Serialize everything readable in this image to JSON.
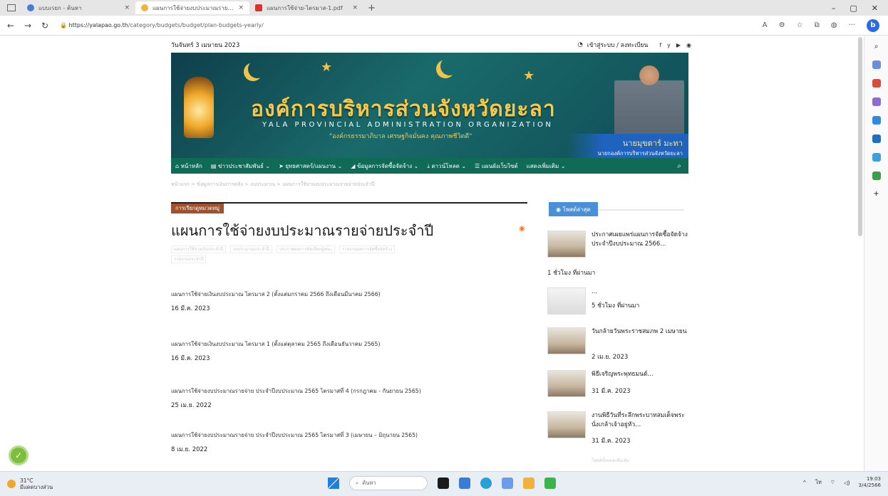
{
  "browser": {
    "tabs": [
      {
        "label": "แบบเรยก - ค้นหา",
        "favicon_color": "#4b7bd8",
        "active": false
      },
      {
        "label": "แผนการใช้จ่ายงบประมาณรายจ่ายประจ",
        "favicon_color": "#f0b43a",
        "active": true
      },
      {
        "label": "แผนการใช้จ่าย-ไตรมาส-1.pdf",
        "favicon_color": "#d9332a",
        "active": false
      }
    ],
    "new_tab_glyph": "+",
    "window_controls": [
      "–",
      "▢",
      "✕"
    ],
    "url_host": "https://yalapao.go.th",
    "url_path": "/category/budgets/budget/plan-budgets-yearly/",
    "bing_label": "b"
  },
  "header": {
    "date": "วันจันทร์ 3 เมษายน 2023",
    "login_label": "เข้าสู่ระบบ / ลงทะเบียน",
    "social": [
      "f",
      "y",
      "▶",
      "◉"
    ]
  },
  "banner": {
    "title": "องค์การบริหารส่วนจังหวัดยะลา",
    "subtitle": "YALA PROVINCIAL ADMINISTRATION ORGANIZATION",
    "motto": "\"องค์กรธรรมาภิบาล เศรษฐกิจมั่นคง คุณภาพชีวิตดี\"",
    "person_name": "นายมุขตาร์ มะทา",
    "person_role": "นายกองค์การบริหารส่วนจังหวัดยะลา"
  },
  "menu": {
    "items": [
      "หน้าหลัก",
      "ข่าวประชาสัมพันธ์",
      "ยุทธศาสตร์/แผนงาน",
      "ข้อมูลการจัดซื้อจัดจ้าง",
      "ดาวน์โหลด",
      "แผนผังเว็บไซต์",
      "แสดงเพิ่มเติม"
    ],
    "search_glyph": "⌕"
  },
  "breadcrumb": "หน้าแรก > ข้อมูลการเงินการคลัง > งบประมาณ > แผนการใช้จ่ายงบประมาณรายจ่ายประจำปี",
  "main": {
    "category_badge": "การเรียกดูหมวดหมู่",
    "title": "แผนการใช้จ่ายงบประมาณรายจ่ายประจำปี",
    "tags": [
      "แผนการใช้จ่ายเงินประจำปี",
      "งบประมาณประจำปี",
      "ประกาศผลการคัดเลือกผู้ชนะ",
      "รายงานผลการจัดซื้อจัดจ้าง",
      "รายงานประจำปี"
    ],
    "posts": [
      {
        "title": "แผนการใช้จ่ายเงินงบประมาณ ไตรมาส 2 (ตั้งแต่มกราคม 2566 ถึงเดือนมีนาคม 2566)",
        "date": "16 มี.ค. 2023"
      },
      {
        "title": "แผนการใช้จ่ายเงินงบประมาณ ไตรมาส 1 (ตั้งแต่ตุลาคม 2565 ถึงเดือนธันวาคม 2565)",
        "date": "16 มี.ค. 2023"
      },
      {
        "title": "แผนการใช้จ่ายงบประมาณรายจ่าย ประจำปีงบประมาณ 2565 ไตรมาสที่ 4 (กรกฎาคม - กันยายน 2565)",
        "date": "25 เม.ย. 2022"
      },
      {
        "title": "แผนการใช้จ่ายงบประมาณรายจ่าย ประจำปีงบประมาณ 2565 ไตรมาสที่ 3 (เมษายน – มิถุนายน 2565)",
        "date": "8 เม.ย. 2022"
      }
    ]
  },
  "sidebar": {
    "badge": "โพสต์ล่าสุด",
    "items": [
      {
        "title": "ประกาศเผยแพร่แผนการจัดซื้อจัดจ้าง ประจำปีงบประมาณ 2566...",
        "time": "1 ชั่วโมง ที่ผ่านมา"
      },
      {
        "title": "...",
        "time": "5 ชั่วโมง ที่ผ่านมา"
      },
      {
        "title": "วันกล้ายวันพระราชสมภพ 2 เมษายน",
        "time": "2 เม.ย. 2023"
      },
      {
        "title": "พิธีเจริญพระพุทธมนต์...",
        "time": "31 มี.ค. 2023"
      },
      {
        "title": "งานพิธีวันที่ระลึกพระบาทสมเด็จพระนั่งเกล้าเจ้าอยู่หัว...",
        "time": "31 มี.ค. 2023"
      }
    ],
    "more_link": "โพสต์ทั้งหมดเพิ่มเติม"
  },
  "taskbar": {
    "weather_temp": "31°C",
    "weather_desc": "มีแดดบางส่วน",
    "search_label": "ค้นหา",
    "app_colors": [
      "#1b1b1b",
      "#3a7bd5",
      "#2aa0d8",
      "#6a9ee8",
      "#f2b13a",
      "#3bb54a"
    ],
    "tray": [
      "^",
      "ไท",
      "⌔",
      "◁)"
    ],
    "time": "19:03",
    "date": "3/4/2566"
  }
}
